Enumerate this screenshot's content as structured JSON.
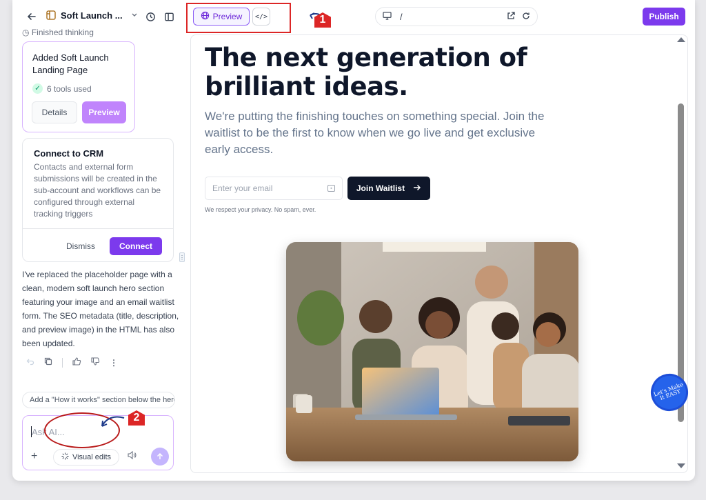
{
  "header": {
    "project_name": "Soft Launch ...",
    "preview_tab": "Preview",
    "code_tab_glyph": "</>",
    "url_path": "/",
    "publish_label": "Publish"
  },
  "annotations": {
    "marker_1": "1",
    "marker_2": "2"
  },
  "chat": {
    "thinking_status": "Finished thinking",
    "added_card": {
      "title": "Added Soft Launch Landing Page",
      "tools_used": "6 tools used",
      "details_label": "Details",
      "preview_label": "Preview"
    },
    "crm_card": {
      "title": "Connect to CRM",
      "description": "Contacts and external form submissions will be created in the sub-account and workflows can be configured through external tracking triggers",
      "dismiss_label": "Dismiss",
      "connect_label": "Connect"
    },
    "message": "I've replaced the placeholder page with a clean, modern soft launch hero section featuring your image and an email waitlist form. The SEO metadata (title, description, and preview image) in the HTML has also been updated.",
    "suggestion": "Add a \"How it works\" section below the hero",
    "composer": {
      "placeholder": "Ask AI...",
      "visual_edits_label": "Visual edits"
    }
  },
  "preview": {
    "headline": "The next generation of brilliant ideas.",
    "subheadline": "We're putting the finishing touches on something special. Join the waitlist to be the first to know when we go live and get exclusive early access.",
    "email_placeholder": "Enter your email",
    "join_label": "Join Waitlist",
    "privacy_note": "We respect your privacy. No spam, ever."
  },
  "watermark": "Let's Make It EASY",
  "colors": {
    "accent": "#7c3aed",
    "accent_light": "#c084fc",
    "annotation_red": "#dc2626",
    "dark_button": "#0f172a"
  },
  "icons": [
    "back-arrow-icon",
    "project-icon",
    "chevron-down-icon",
    "history-icon",
    "sidebar-toggle-icon",
    "globe-icon",
    "code-icon",
    "desktop-icon",
    "open-external-icon",
    "refresh-icon",
    "check-icon",
    "undo-icon",
    "copy-icon",
    "thumbs-up-icon",
    "thumbs-down-icon",
    "more-icon",
    "plus-icon",
    "sparkle-icon",
    "speaker-icon",
    "send-arrow-icon",
    "arrow-right-icon"
  ]
}
